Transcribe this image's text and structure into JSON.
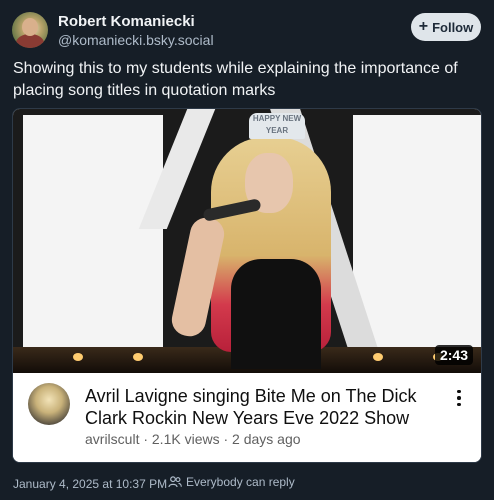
{
  "author": {
    "name": "Robert Komaniecki",
    "handle": "@komaniecki.bsky.social"
  },
  "follow_button": {
    "label": "Follow",
    "icon": "plus-icon"
  },
  "post": {
    "text": "Showing this to my students while explaining the importance of placing song titles in quotation marks"
  },
  "embed": {
    "thumbnail_overlay": "HAPPY NEW YEAR",
    "duration": "2:43",
    "title": "Avril Lavigne singing Bite Me on The Dick Clark Rockin New Years Eve 2022 Show",
    "channel": "avrilscult",
    "views": "2.1K views",
    "age": "2 days ago",
    "subline": "avrilscult · 2.1K views · 2 days ago",
    "more_icon": "more-vertical-icon"
  },
  "footer": {
    "timestamp": "January 4, 2025 at 10:37 PM",
    "reply_setting": "Everybody can reply",
    "reply_icon": "people-icon"
  },
  "colors": {
    "background": "#161e27",
    "muted_text": "#aebbc9",
    "follow_bg": "#dfe5ea"
  }
}
